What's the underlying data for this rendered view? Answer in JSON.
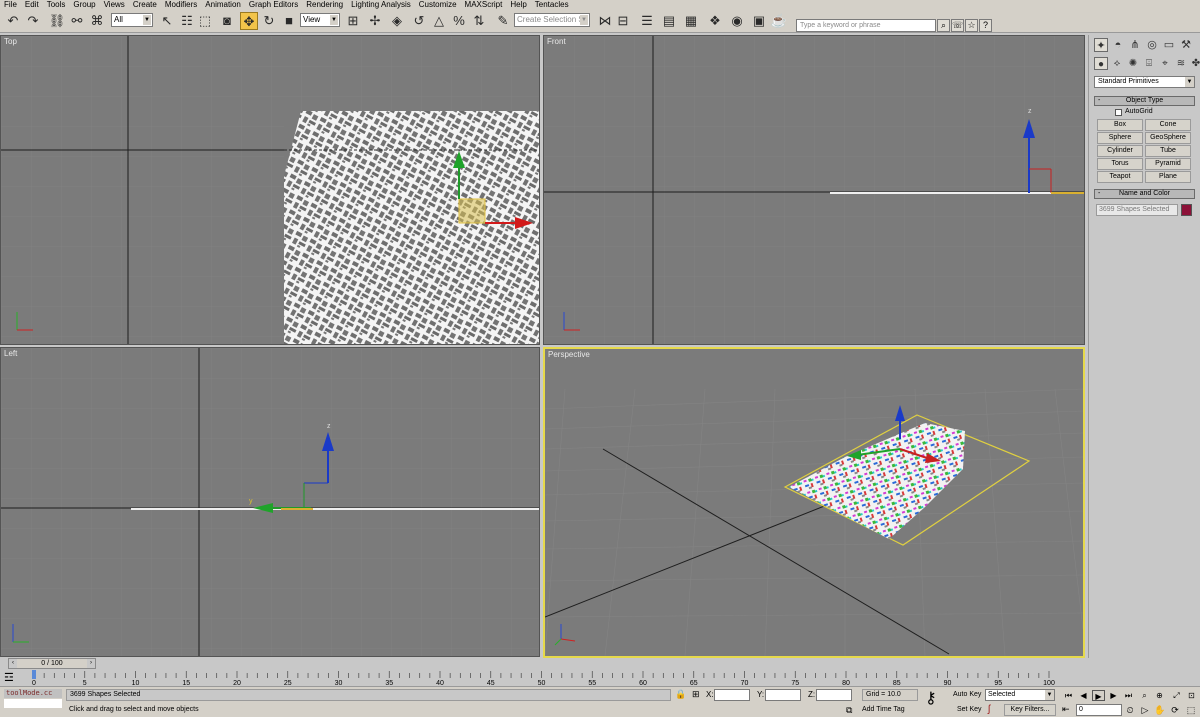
{
  "menu": [
    "File",
    "Edit",
    "Tools",
    "Group",
    "Views",
    "Create",
    "Modifiers",
    "Animation",
    "Graph Editors",
    "Rendering",
    "Lighting Analysis",
    "Customize",
    "MAXScript",
    "Help",
    "Tentacles"
  ],
  "toolbar": {
    "selection_filter": "All",
    "reference_coord": "View",
    "named_selection_placeholder": "Create Selection Se",
    "search_placeholder": "Type a keyword or phrase"
  },
  "viewports": {
    "top": "Top",
    "front": "Front",
    "left": "Left",
    "perspective": "Perspective"
  },
  "axis_labels": {
    "x": "x",
    "y": "y",
    "z": "z"
  },
  "command_panel": {
    "category": "Standard Primitives",
    "object_type_title": "Object Type",
    "autogrid": "AutoGrid",
    "buttons": [
      "Box",
      "Cone",
      "Sphere",
      "GeoSphere",
      "Cylinder",
      "Tube",
      "Torus",
      "Pyramid",
      "Teapot",
      "Plane"
    ],
    "name_color_title": "Name and Color",
    "name_value": "3699 Shapes Selected",
    "object_color": "#8c1138",
    "rollout_toggle": "-"
  },
  "timeline": {
    "slider_label": "0 / 100",
    "ticks": [
      0,
      5,
      10,
      15,
      20,
      25,
      30,
      35,
      40,
      45,
      50,
      55,
      60,
      65,
      70,
      75,
      80,
      85,
      90,
      95,
      100
    ]
  },
  "status": {
    "maxscript_text": "toolMode.cc",
    "selection_info": "3699 Shapes Selected",
    "prompt": "Click and drag to select and move objects",
    "x_label": "X:",
    "y_label": "Y:",
    "z_label": "Z:",
    "grid": "Grid = 10.0",
    "add_time_tag": "Add Time Tag",
    "auto_key": "Auto Key",
    "set_key": "Set Key",
    "key_mode": "Selected",
    "key_filters": "Key Filters...",
    "current_frame": "0"
  }
}
